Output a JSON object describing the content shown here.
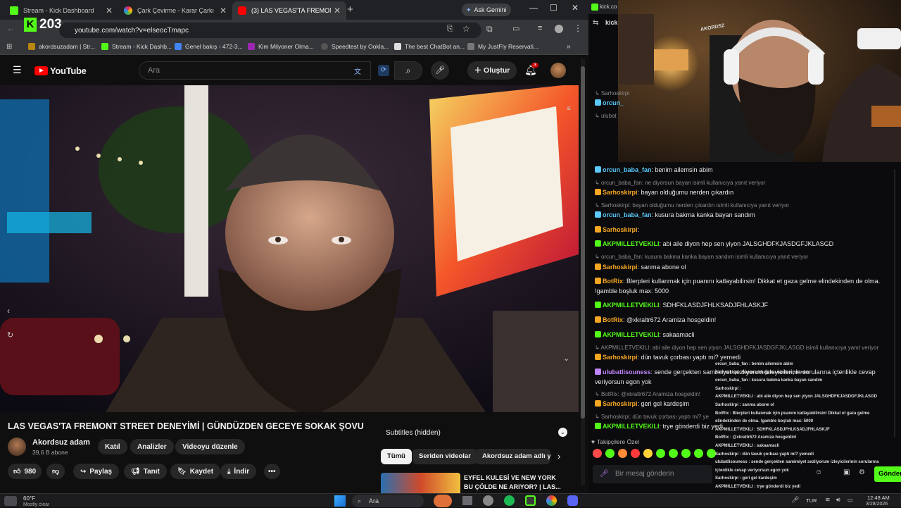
{
  "browser": {
    "tabs": [
      {
        "label": "Stream - Kick Dashboard",
        "icon": "kick-icon"
      },
      {
        "label": "Çark Çevirme - Karar Çarkı",
        "icon": "wheel-icon"
      },
      {
        "label": "(3) LAS VEGAS'TA FREMONT S...",
        "icon": "youtube-icon"
      }
    ],
    "ask_gemini": "Ask Gemini",
    "url": "youtube.com/watch?v=elseocTmapc",
    "kick_overlay_count": "203",
    "bookmarks": [
      "akordsuzadam | Str...",
      "Stream - Kick Dashb...",
      "Genel bakış - 472-3...",
      "Kim Milyoner Olma...",
      "Speedtest by Ookla...",
      "The best ChatBot an...",
      "My JustFly Reservati..."
    ]
  },
  "youtube": {
    "logo": "YouTube",
    "search_placeholder": "Ara",
    "create_label": "Oluştur",
    "notif_count": "3",
    "video_title": "LAS VEGAS'TA FREMONT STREET DENEYİMİ | GÜNDÜZDEN GECEYE SOKAK ŞOVU",
    "channel_name": "Akordsuz adam",
    "subscribers": "39,6 B abone",
    "join_label": "Katıl",
    "analytics_label": "Analizler",
    "edit_label": "Videoyu düzenle",
    "likes": "980",
    "share_label": "Paylaş",
    "promote_label": "Tanıt",
    "save_label": "Kaydet",
    "download_label": "İndir",
    "subtitles": "Subtitles (hidden)",
    "chips": [
      "Tümü",
      "Seriden videolar",
      "Akordsuz adam adlı y"
    ],
    "related_title_1": "EYFEL KULESİ VE NEW YORK",
    "related_title_2": "BU ÇÖLDE NE ARIYOR? | LAS..."
  },
  "kick": {
    "url_fragment": "kick.co",
    "header_fragment": "kick",
    "followers_mode": "Takipçilere Özel",
    "message_placeholder": "Bir mesaj gönderin",
    "send_label": "Gönder",
    "webcam_sign": "AKORDSZ",
    "chat": [
      {
        "kind": "reply",
        "text": "Sarhoskirpi"
      },
      {
        "kind": "user",
        "user": "orcun_",
        "msg": "",
        "color": "#5ac8fa"
      },
      {
        "kind": "reply",
        "text": "ulubat"
      },
      {
        "kind": "user",
        "user": "orcun_baba_fan",
        "msg": ": benim ailemsin abim",
        "color": "#5ac8fa"
      },
      {
        "kind": "reply",
        "text": "orcun_baba_fan: ne diyorsun bayan isimli kullanıcıya yanıt veriyor"
      },
      {
        "kind": "user",
        "user": "Sarhoskirpi",
        "msg": ": bayan olduğumu nerden çıkardın",
        "color": "#f5a623"
      },
      {
        "kind": "reply",
        "text": "Sarhoskirpi: bayan olduğumu nerden çıkardın isimli kullanıcıya yanıt veriyor"
      },
      {
        "kind": "user",
        "user": "orcun_baba_fan",
        "msg": ": kusura bakma kanka bayan sandım",
        "color": "#5ac8fa"
      },
      {
        "kind": "user",
        "user": "Sarhoskirpi",
        "msg": ":",
        "color": "#f5a623"
      },
      {
        "kind": "user",
        "user": "AKPMILLETVEKILI",
        "msg": ": abi aile diyon hep sen yiyon JALSGHDFKJASDGFJKLASGD",
        "color": "#53fc18"
      },
      {
        "kind": "reply",
        "text": "orcun_baba_fan: kusura bakma kanka bayan sandım isimli kullanıcıya yanıt veriyor"
      },
      {
        "kind": "user",
        "user": "Sarhoskirpi",
        "msg": ": sanma abone ol",
        "color": "#f5a623"
      },
      {
        "kind": "user",
        "user": "BotRix",
        "msg": ": Blerpleri kullanmak için puanını katlayabilirsin! Dikkat et gaza gelme elindekinden de olma.",
        "color": "#f5a623"
      },
      {
        "kind": "plain",
        "text": "!gamble boşluk max: 5000"
      },
      {
        "kind": "user",
        "user": "AKPMILLETVEKILI",
        "msg": ": SDHFKLASDJFHLKSADJFHLASKJF",
        "color": "#53fc18"
      },
      {
        "kind": "user",
        "user": "BotRix",
        "msg": ": @xkraltr672 Aramiza hosgeldin!",
        "color": "#f5a623"
      },
      {
        "kind": "user",
        "user": "AKPMILLETVEKILI",
        "msg": ": sakaamacli",
        "color": "#53fc18"
      },
      {
        "kind": "reply",
        "text": "AKPMILLETVEKILI: abi aile diyon hep sen yiyon JALSGHDFKJASDGFJKLASGD isimli kullanıcıya yanıt veriyor"
      },
      {
        "kind": "user",
        "user": "Sarhoskirpi",
        "msg": ": dün tavuk çorbası yaptı mi? yemedi",
        "color": "#f5a623"
      },
      {
        "kind": "user",
        "user": "ulubatlisouness",
        "msg": ": sende gerçekten samimiyet sezliyorum izleyicilerinin sorularına içtenlikle cevap",
        "color": "#c084fc"
      },
      {
        "kind": "plain",
        "text": "veriyorsun egon yok"
      },
      {
        "kind": "reply",
        "text": "BotRix: @xkraltr672 Aramiza hosgeldin!"
      },
      {
        "kind": "user",
        "user": "Sarhoskirpi",
        "msg": ": geri gel kardeşim",
        "color": "#f5a623"
      },
      {
        "kind": "reply",
        "text": "Sarhoskirpi: dün tavuk çorbası yaptı mi? ye"
      },
      {
        "kind": "user",
        "user": "AKPMILLETVEKILI",
        "msg": ": trye gönderdi biz yedi",
        "color": "#53fc18"
      }
    ],
    "overlay_chat": [
      "orcun_baba_fan : benim ailemsin abim",
      "Sarhoskirpi : bayan olduğumu nerden çıkardın",
      "orcun_baba_fan : kusura bakma kanka bayan sandım",
      "Sarhoskirpi :",
      "AKPMILLETVEKILI : abi aile diyon hep sen yiyon JALSGHDFKJASDGFJKLASGD",
      "Sarhoskirpi : sanma abone ol",
      "BotRix : Blerpleri kullanmak için puanını katlayabilirsin! Dikkat et gaza gelme",
      "elindekinden de olma. !gamble boşluk max: 5000",
      "AKPMILLETVEKILI : SDHFKLASDJFHLKSADJFHLASKJF",
      "BotRix : @xkraltr672 Aramiza hosgeldin!",
      "AKPMILLETVEKILI : sakaamacli",
      "Sarhoskirpi : dün tavuk çorbası yaptı mi? yemedi",
      "ulubatlisouness : sende gerçekten samimiyet sezliyorum izleyicilerinin sorularına",
      "içtenlikle cevap veriyorsun egon yok",
      "Sarhoskirpi : geri gel kardeşim",
      "AKPMILLETVEKILI : trye gönderdi biz yedi"
    ]
  },
  "taskbar": {
    "weather_temp": "60°F",
    "weather_desc": "Mostly clear",
    "search_label": "Ara",
    "lang": "TUR",
    "time": "12:48 AM",
    "date": "3/28/2026"
  },
  "colors": {
    "kick_green": "#53fc18",
    "yt_red": "#ff0000"
  }
}
